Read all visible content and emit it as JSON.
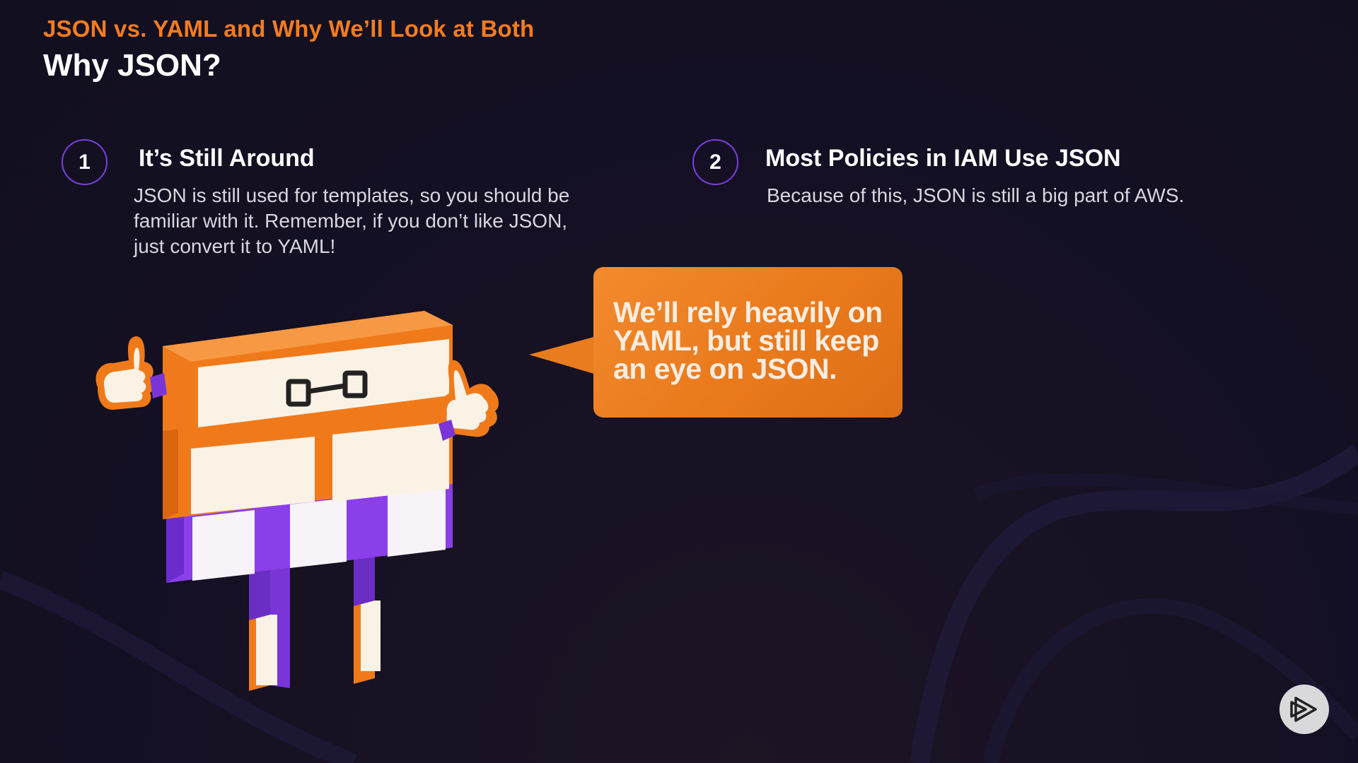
{
  "slide": {
    "subtitle": "JSON vs. YAML and Why We’ll Look at Both",
    "title": "Why JSON?"
  },
  "points": [
    {
      "number": "1",
      "heading": "It’s Still Around",
      "body_lines": [
        "JSON is still used for templates, so you should be",
        "familiar with it. Remember, if you don’t like JSON,",
        "just convert it to YAML!"
      ]
    },
    {
      "number": "2",
      "heading": "Most Policies in IAM Use JSON",
      "body_lines": [
        "Because of this, JSON is still a big part of AWS."
      ]
    }
  ],
  "speech_bubble": {
    "lines": [
      "We’ll rely heavily on",
      "YAML, but still keep",
      "an eye on JSON."
    ]
  },
  "colors": {
    "accent_orange": "#f47c20",
    "accent_purple": "#7a3fe0",
    "background": "#141023"
  },
  "icons": {
    "play": "play-logo-icon"
  }
}
